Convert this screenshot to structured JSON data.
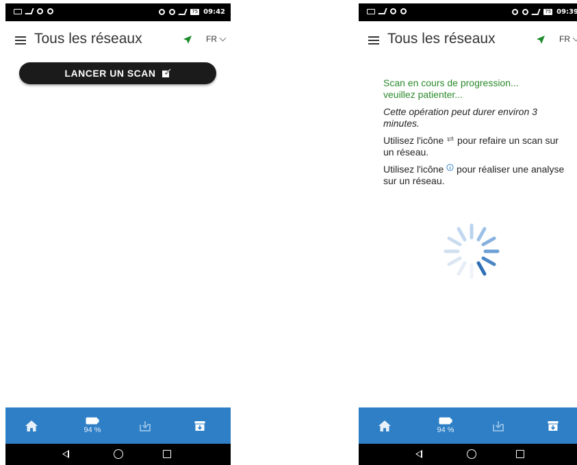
{
  "screens": [
    {
      "status_bar": {
        "clock": "09:42",
        "battery": "75"
      },
      "header": {
        "title": "Tous les réseaux",
        "language": "FR"
      },
      "scan_button": {
        "label": "LANCER UN SCAN"
      },
      "bottom_nav": {
        "battery_percent": "94 %"
      }
    },
    {
      "status_bar": {
        "clock": "09:39",
        "battery": "75"
      },
      "header": {
        "title": "Tous les réseaux",
        "language": "FR"
      },
      "scan_info": {
        "progress_line1": "Scan en cours de progression...",
        "progress_line2": "veuillez patienter...",
        "duration_note": "Cette opération peut durer environ 3 minutes.",
        "rescan_before": "Utilisez l'icône",
        "rescan_after": "pour refaire un scan sur un réseau.",
        "analyze_before": "Utilisez l'icône",
        "analyze_after": "pour réaliser une analyse sur un réseau."
      },
      "bottom_nav": {
        "battery_percent": "94 %"
      }
    }
  ],
  "colors": {
    "accent_blue": "#2e7fc6",
    "progress_green": "#2a8a2a",
    "location_green": "#1a8a2a",
    "button_dark": "#1b1b1b"
  },
  "icons": {
    "menu": "menu-icon",
    "location": "location-arrow-icon",
    "language_dropdown": "chevron-down-icon",
    "scan_button": "external-link-icon",
    "rescan": "repeat-icon",
    "analyze": "info-icon",
    "nav": [
      "home-icon",
      "battery-icon",
      "download-icon",
      "archive-icon"
    ],
    "system": [
      "back-icon",
      "home-circle-icon",
      "recent-apps-icon"
    ]
  }
}
